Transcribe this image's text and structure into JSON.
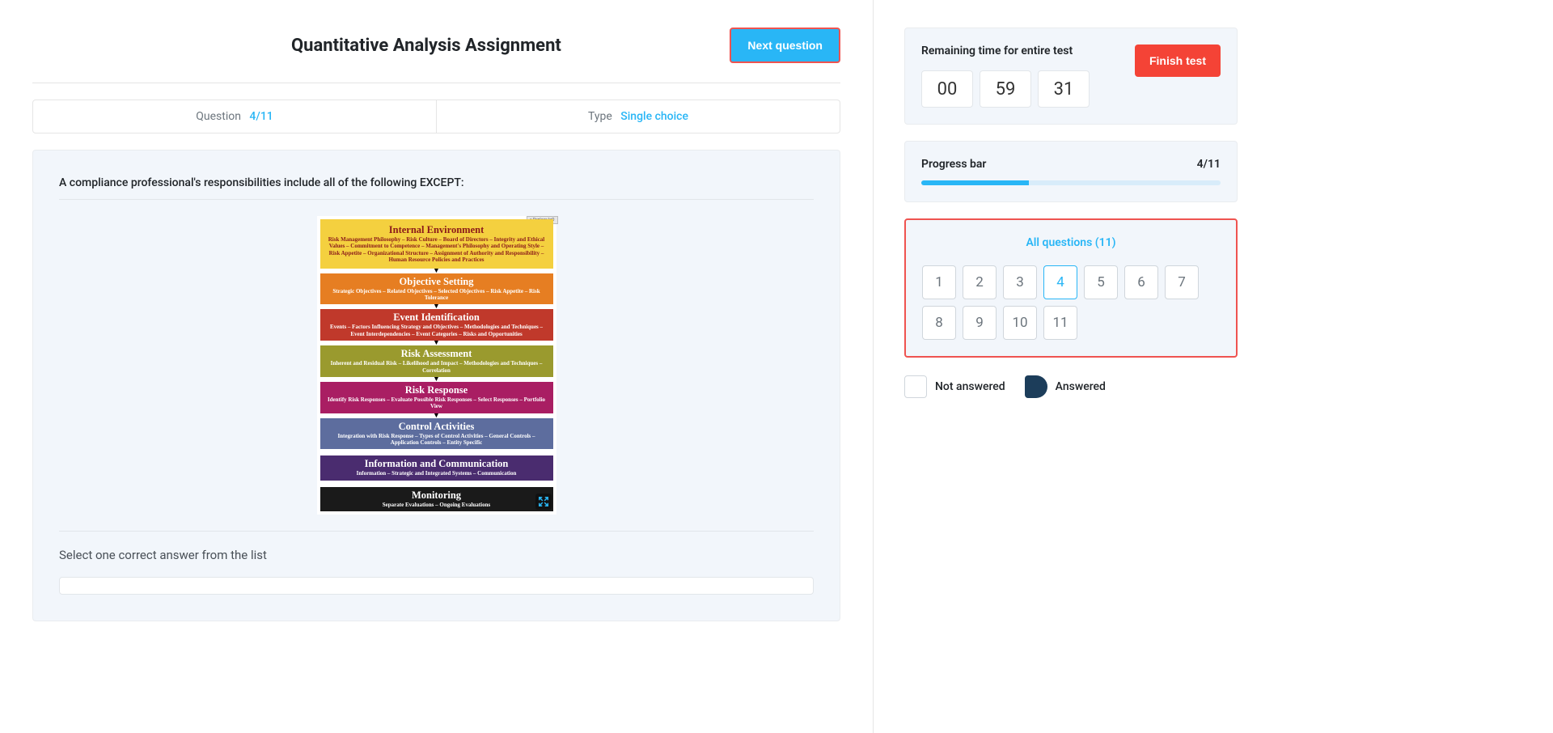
{
  "assignment_title": "Quantitative Analysis Assignment",
  "next_button": "Next question",
  "meta": {
    "question_label": "Question",
    "question_value": "4/11",
    "type_label": "Type",
    "type_value": "Single choice"
  },
  "question": {
    "text": "A compliance professional's responsibilities include all of the following EXCEPT:",
    "instruction": "Select one correct answer from the list",
    "replace_tag": "× Replace IoO"
  },
  "coso": {
    "b1": {
      "title": "Internal Environment",
      "sub": "Risk Management Philosophy – Risk Culture – Board of Directors – Integrity and Ethical Values – Commitment to Competence – Management's Philosophy and Operating Style – Risk Appetite – Organizational Structure – Assignment of Authority and Responsibility – Human Resource Policies and Practices"
    },
    "b2": {
      "title": "Objective Setting",
      "sub": "Strategic Objectives – Related Objectives – Selected Objectives – Risk Appetite – Risk Tolerance"
    },
    "b3": {
      "title": "Event Identification",
      "sub": "Events – Factors Influencing Strategy and Objectives – Methodologies and Techniques – Event Interdependencies – Event Categories – Risks and Opportunities"
    },
    "b4": {
      "title": "Risk Assessment",
      "sub": "Inherent and Residual Risk – Likelihood and Impact – Methodologies and Techniques – Correlation"
    },
    "b5": {
      "title": "Risk Response",
      "sub": "Identify Risk Responses – Evaluate Possible Risk Responses – Select Responses – Portfolio View"
    },
    "b6": {
      "title": "Control Activities",
      "sub": "Integration with Risk Response – Types of Control Activities – General Controls – Application Controls – Entity Specific"
    },
    "b7": {
      "title": "Information and Communication",
      "sub": "Information – Strategic and Integrated Systems – Communication"
    },
    "b8": {
      "title": "Monitoring",
      "sub": "Separate Evaluations – Ongoing Evaluations"
    }
  },
  "timer": {
    "label": "Remaining time for entire test",
    "hh": "00",
    "mm": "59",
    "ss": "31",
    "finish": "Finish test"
  },
  "progress": {
    "label": "Progress bar",
    "value": "4/11",
    "percent": 36
  },
  "allq": {
    "title": "All questions (11)",
    "numbers": [
      "1",
      "2",
      "3",
      "4",
      "5",
      "6",
      "7",
      "8",
      "9",
      "10",
      "11"
    ],
    "active": "4"
  },
  "legend": {
    "not_answered": "Not answered",
    "answered": "Answered"
  },
  "colors": {
    "b1": "#f4d03f",
    "b1_text": "#8b1a1a",
    "b2": "#e67e22",
    "b3": "#c0392b",
    "b4": "#9a9a2e",
    "b5": "#a91e63",
    "b6": "#5d6d9e",
    "b7": "#4a2c6f",
    "b8": "#1a1a1a"
  }
}
